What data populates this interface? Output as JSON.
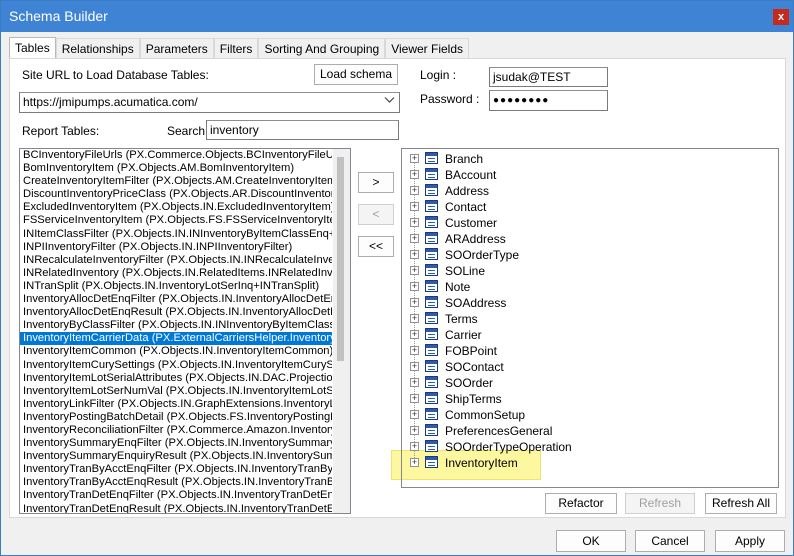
{
  "window": {
    "title": "Schema Builder",
    "close_glyph": "x"
  },
  "tabs": [
    {
      "label": "Tables",
      "active": true
    },
    {
      "label": "Relationships",
      "active": false
    },
    {
      "label": "Parameters",
      "active": false
    },
    {
      "label": "Filters",
      "active": false
    },
    {
      "label": "Sorting And Grouping",
      "active": false
    },
    {
      "label": "Viewer Fields",
      "active": false
    }
  ],
  "site": {
    "label": "Site URL to Load Database Tables:",
    "load_button": "Load schema",
    "url_value": "https://jmipumps.acumatica.com/"
  },
  "login": {
    "login_label": "Login :",
    "login_value": "jsudak@TEST",
    "password_label": "Password :",
    "password_value": "●●●●●●●●"
  },
  "report_tables": {
    "label": "Report Tables:",
    "search_label": "Search:",
    "search_value": "inventory",
    "items": [
      "BCInventoryFileUrls (PX.Commerce.Objects.BCInventoryFileUrls)",
      "BomInventoryItem (PX.Objects.AM.BomInventoryItem)",
      "CreateInventoryItemFilter (PX.Objects.AM.CreateInventoryItemPro",
      "DiscountInventoryPriceClass (PX.Objects.AR.DiscountInventoryP",
      "ExcludedInventoryItem (PX.Objects.IN.ExcludedInventoryItem)",
      "FSServiceInventoryItem (PX.Objects.FS.FSServiceInventoryItem)",
      "INItemClassFilter (PX.Objects.IN.INInventoryByItemClassEnq+INIt",
      "INPIInventoryFilter (PX.Objects.IN.INPIInventoryFilter)",
      "INRecalculateInventoryFilter (PX.Objects.IN.INRecalculateInvent",
      "INRelatedInventory (PX.Objects.IN.RelatedItems.INRelatedInvent",
      "INTranSplit (PX.Objects.IN.InventoryLotSerInq+INTranSplit)",
      "InventoryAllocDetEnqFilter (PX.Objects.IN.InventoryAllocDetEnqF",
      "InventoryAllocDetEnqResult (PX.Objects.IN.InventoryAllocDetEnq",
      "InventoryByClassFilter (PX.Objects.IN.INInventoryByItemClassEnq",
      "InventoryItemCarrierData (PX.ExternalCarriersHelper.InventoryItem",
      "InventoryItemCommon (PX.Objects.IN.InventoryItemCommon)",
      "InventoryItemCurySettings (PX.Objects.IN.InventoryItemCurySettin",
      "InventoryItemLotSerialAttributes (PX.Objects.IN.DAC.Projections.I",
      "InventoryItemLotSerNumVal (PX.Objects.IN.InventoryItemLotSerN",
      "InventoryLinkFilter (PX.Objects.IN.GraphExtensions.InventoryLink",
      "InventoryPostingBatchDetail (PX.Objects.FS.InventoryPostingBatc",
      "InventoryReconciliationFilter (PX.Commerce.Amazon.InventoryRe",
      "InventorySummaryEnqFilter (PX.Objects.IN.InventorySummaryEnq",
      "InventorySummaryEnquiryResult (PX.Objects.IN.InventorySumma",
      "InventoryTranByAcctEnqFilter (PX.Objects.IN.InventoryTranByAc",
      "InventoryTranByAcctEnqResult (PX.Objects.IN.InventoryTranByA",
      "InventoryTranDetEnqFilter (PX.Objects.IN.InventoryTranDetEnqF",
      "InventoryTranDetEnqResult (PX.Objects.IN.InventoryTranDetEnq"
    ],
    "selected_index": 14
  },
  "move_buttons": {
    "add": ">",
    "remove": "<",
    "remove_all": "<<"
  },
  "tree": {
    "expander_glyph": "+",
    "nodes": [
      "Branch",
      "BAccount",
      "Address",
      "Contact",
      "Customer",
      "ARAddress",
      "SOOrderType",
      "SOLine",
      "Note",
      "SOAddress",
      "Terms",
      "Carrier",
      "FOBPoint",
      "SOContact",
      "SOOrder",
      "ShipTerms",
      "CommonSetup",
      "PreferencesGeneral",
      "SOOrderTypeOperation",
      "InventoryItem"
    ],
    "highlighted_node": "InventoryItem",
    "highlight_color": "#fdf7a0"
  },
  "tree_buttons": {
    "refactor": "Refactor",
    "refresh": "Refresh",
    "refresh_all": "Refresh All"
  },
  "dialog_buttons": {
    "ok": "OK",
    "cancel": "Cancel",
    "apply": "Apply"
  },
  "colors": {
    "titlebar": "#3f84d4",
    "selection": "#0078d7",
    "close": "#c42b1c"
  }
}
